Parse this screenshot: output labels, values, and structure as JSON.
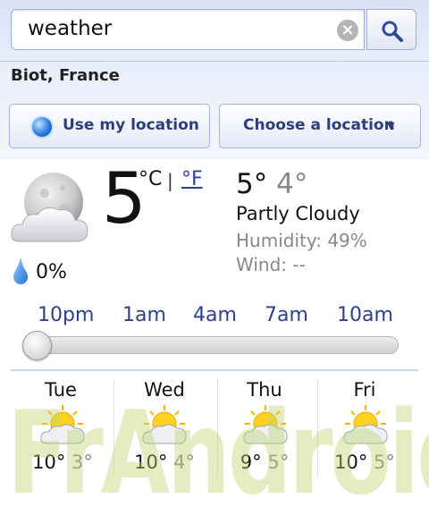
{
  "search": {
    "query": "weather"
  },
  "location": {
    "name": "Biot, France"
  },
  "buttons": {
    "use_location": "Use my location",
    "choose_location": "Choose a location",
    "choose_arrow": "▼"
  },
  "current": {
    "temp": "5",
    "unit_c": "°C",
    "unit_sep": "|",
    "unit_f": "°F",
    "precip": "0%",
    "high": "5°",
    "low": "4°",
    "condition": "Partly Cloudy",
    "humidity": "Humidity: 49%",
    "wind": "Wind: --",
    "icon": "moon-cloud-icon"
  },
  "hourly": {
    "times": [
      "10pm",
      "1am",
      "4am",
      "7am",
      "10am"
    ],
    "selected_index": 0
  },
  "forecast": [
    {
      "day": "Tue",
      "high": "10°",
      "low": "3°",
      "icon": "sun-cloud-icon"
    },
    {
      "day": "Wed",
      "high": "10°",
      "low": "4°",
      "icon": "sun-cloud-icon"
    },
    {
      "day": "Thu",
      "high": "9°",
      "low": "5°",
      "icon": "sun-cloud-icon"
    },
    {
      "day": "Fri",
      "high": "10°",
      "low": "5°",
      "icon": "sun-cloud-icon"
    }
  ],
  "watermark": {
    "text": "FrAndroid"
  },
  "colors": {
    "accent_blue": "#2d3f8f",
    "link": "#2a3fa5",
    "muted": "#888888"
  }
}
